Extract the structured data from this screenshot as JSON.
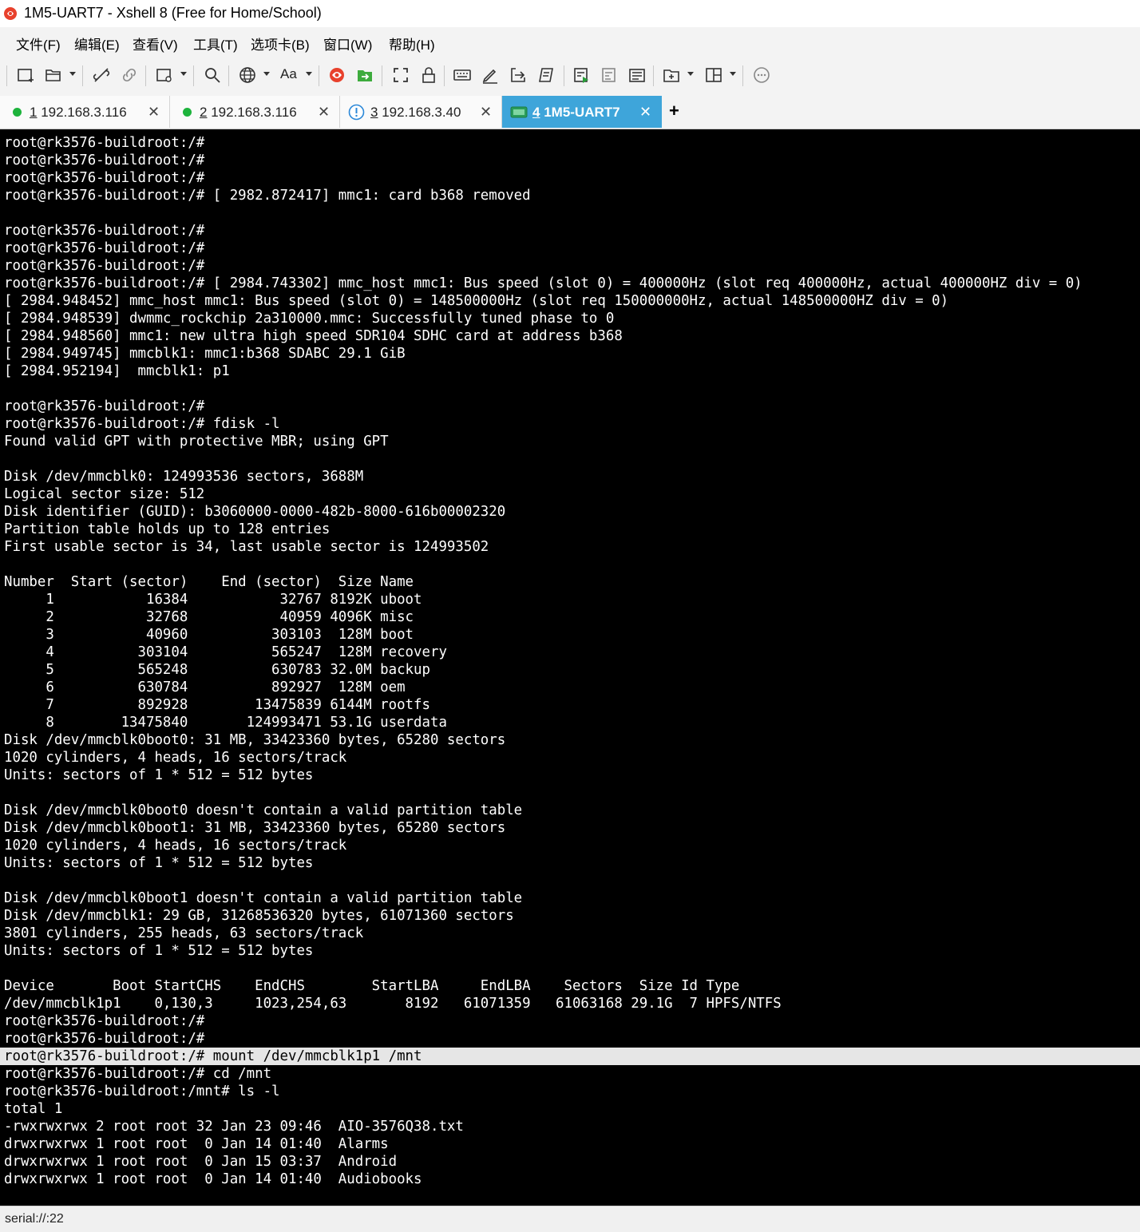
{
  "window": {
    "title": "1M5-UART7 - Xshell 8 (Free for Home/School)"
  },
  "menu": {
    "items": [
      "文件(F)",
      "编辑(E)",
      "查看(V)",
      "工具(T)",
      "选项卡(B)",
      "窗口(W)",
      "帮助(H)"
    ]
  },
  "toolbar": {
    "font_label": "Aa",
    "icons": [
      "new-session-icon",
      "open-folder-icon",
      "disconnect-icon",
      "link-icon",
      "properties-icon",
      "search-icon",
      "globe-icon",
      "font-icon",
      "xshell-logo-icon",
      "xftp-icon",
      "fullscreen-icon",
      "lock-icon",
      "keyboard-icon",
      "pen-icon",
      "send-icon",
      "script-icon",
      "log-icon",
      "compose-icon",
      "list-icon",
      "new-tab-icon",
      "layout-icon",
      "chat-icon"
    ]
  },
  "tabs": [
    {
      "index": "1",
      "label": "192.168.3.116",
      "status": "connected"
    },
    {
      "index": "2",
      "label": "192.168.3.116",
      "status": "connected"
    },
    {
      "index": "3",
      "label": "192.168.3.40",
      "status": "warning"
    },
    {
      "index": "4",
      "label": "1M5-UART7",
      "status": "serial",
      "active": true
    }
  ],
  "new_tab_label": "+",
  "terminal": {
    "highlighted_line": 52,
    "lines": [
      "root@rk3576-buildroot:/#",
      "root@rk3576-buildroot:/#",
      "root@rk3576-buildroot:/#",
      "root@rk3576-buildroot:/# [ 2982.872417] mmc1: card b368 removed",
      "",
      "root@rk3576-buildroot:/#",
      "root@rk3576-buildroot:/#",
      "root@rk3576-buildroot:/#",
      "root@rk3576-buildroot:/# [ 2984.743302] mmc_host mmc1: Bus speed (slot 0) = 400000Hz (slot req 400000Hz, actual 400000HZ div = 0)",
      "[ 2984.948452] mmc_host mmc1: Bus speed (slot 0) = 148500000Hz (slot req 150000000Hz, actual 148500000HZ div = 0)",
      "[ 2984.948539] dwmmc_rockchip 2a310000.mmc: Successfully tuned phase to 0",
      "[ 2984.948560] mmc1: new ultra high speed SDR104 SDHC card at address b368",
      "[ 2984.949745] mmcblk1: mmc1:b368 SDABC 29.1 GiB",
      "[ 2984.952194]  mmcblk1: p1",
      "",
      "root@rk3576-buildroot:/#",
      "root@rk3576-buildroot:/# fdisk -l",
      "Found valid GPT with protective MBR; using GPT",
      "",
      "Disk /dev/mmcblk0: 124993536 sectors, 3688M",
      "Logical sector size: 512",
      "Disk identifier (GUID): b3060000-0000-482b-8000-616b00002320",
      "Partition table holds up to 128 entries",
      "First usable sector is 34, last usable sector is 124993502",
      "",
      "Number  Start (sector)    End (sector)  Size Name",
      "     1           16384           32767 8192K uboot",
      "     2           32768           40959 4096K misc",
      "     3           40960          303103  128M boot",
      "     4          303104          565247  128M recovery",
      "     5          565248          630783 32.0M backup",
      "     6          630784          892927  128M oem",
      "     7          892928        13475839 6144M rootfs",
      "     8        13475840       124993471 53.1G userdata",
      "Disk /dev/mmcblk0boot0: 31 MB, 33423360 bytes, 65280 sectors",
      "1020 cylinders, 4 heads, 16 sectors/track",
      "Units: sectors of 1 * 512 = 512 bytes",
      "",
      "Disk /dev/mmcblk0boot0 doesn't contain a valid partition table",
      "Disk /dev/mmcblk0boot1: 31 MB, 33423360 bytes, 65280 sectors",
      "1020 cylinders, 4 heads, 16 sectors/track",
      "Units: sectors of 1 * 512 = 512 bytes",
      "",
      "Disk /dev/mmcblk0boot1 doesn't contain a valid partition table",
      "Disk /dev/mmcblk1: 29 GB, 31268536320 bytes, 61071360 sectors",
      "3801 cylinders, 255 heads, 63 sectors/track",
      "Units: sectors of 1 * 512 = 512 bytes",
      "",
      "Device       Boot StartCHS    EndCHS        StartLBA     EndLBA    Sectors  Size Id Type",
      "/dev/mmcblk1p1    0,130,3     1023,254,63       8192   61071359   61063168 29.1G  7 HPFS/NTFS",
      "root@rk3576-buildroot:/#",
      "root@rk3576-buildroot:/#",
      "root@rk3576-buildroot:/# mount /dev/mmcblk1p1 /mnt",
      "root@rk3576-buildroot:/# cd /mnt",
      "root@rk3576-buildroot:/mnt# ls -l",
      "total 1",
      "-rwxrwxrwx 2 root root 32 Jan 23 09:46  AIO-3576Q38.txt",
      "drwxrwxrwx 1 root root  0 Jan 14 01:40  Alarms",
      "drwxrwxrwx 1 root root  0 Jan 15 03:37  Android",
      "drwxrwxrwx 1 root root  0 Jan 14 01:40  Audiobooks"
    ]
  },
  "status": {
    "text": "serial://:22"
  }
}
